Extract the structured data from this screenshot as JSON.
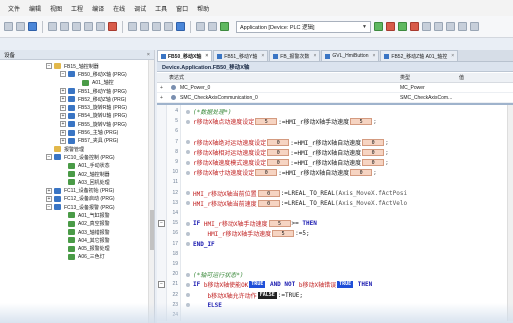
{
  "menu": [
    "文件",
    "编辑",
    "视图",
    "工程",
    "编译",
    "在线",
    "调试",
    "工具",
    "窗口",
    "帮助"
  ],
  "toolbar": {
    "app_select": "Application [Device: PLC 逻辑]"
  },
  "tree_panel": {
    "title": "设备",
    "close": "×",
    "items": [
      {
        "label": "FB15_轴控制器",
        "indent": 46,
        "exp": "−",
        "icon": "fld"
      },
      {
        "label": "FB50_移动X轴 (PRG)",
        "indent": 60,
        "exp": "−",
        "icon": "prg"
      },
      {
        "label": "A01_轴控",
        "indent": 74,
        "exp": "",
        "icon": "act"
      },
      {
        "label": "FB51_移动Y轴 (PRG)",
        "indent": 60,
        "exp": "+",
        "icon": "prg"
      },
      {
        "label": "FB52_移动Z轴 (PRG)",
        "indent": 60,
        "exp": "+",
        "icon": "prg"
      },
      {
        "label": "FB53_旋转R轴 (PRG)",
        "indent": 60,
        "exp": "+",
        "icon": "prg"
      },
      {
        "label": "FB54_旋转U轴 (PRG)",
        "indent": 60,
        "exp": "+",
        "icon": "prg"
      },
      {
        "label": "FB55_旋转V轴 (PRG)",
        "indent": 60,
        "exp": "+",
        "icon": "prg"
      },
      {
        "label": "FB56_主轴 (PRG)",
        "indent": 60,
        "exp": "+",
        "icon": "prg"
      },
      {
        "label": "FB57_夹具 (PRG)",
        "indent": 60,
        "exp": "+",
        "icon": "prg"
      },
      {
        "label": "报警管理",
        "indent": 46,
        "exp": "",
        "icon": "fld"
      },
      {
        "label": "FC10_设备控制 (PRG)",
        "indent": 46,
        "exp": "−",
        "icon": "prg"
      },
      {
        "label": "A01_手动状态",
        "indent": 60,
        "exp": "",
        "icon": "act"
      },
      {
        "label": "A02_轴控制器",
        "indent": 60,
        "exp": "",
        "icon": "act"
      },
      {
        "label": "A03_回机处理",
        "indent": 60,
        "exp": "",
        "icon": "act"
      },
      {
        "label": "FC11_设备初始 (PRG)",
        "indent": 46,
        "exp": "+",
        "icon": "prg"
      },
      {
        "label": "FC12_设备启动 (PRG)",
        "indent": 46,
        "exp": "+",
        "icon": "prg"
      },
      {
        "label": "FC13_设备报警 (PRG)",
        "indent": 46,
        "exp": "−",
        "icon": "prg"
      },
      {
        "label": "A01_气缸报警",
        "indent": 60,
        "exp": "",
        "icon": "act"
      },
      {
        "label": "A02_真空报警",
        "indent": 60,
        "exp": "",
        "icon": "act"
      },
      {
        "label": "A03_轴错报警",
        "indent": 60,
        "exp": "",
        "icon": "act"
      },
      {
        "label": "A04_其它报警",
        "indent": 60,
        "exp": "",
        "icon": "act"
      },
      {
        "label": "A05_报警处理",
        "indent": 60,
        "exp": "",
        "icon": "act"
      },
      {
        "label": "A06_三色灯",
        "indent": 60,
        "exp": "",
        "icon": "act"
      }
    ]
  },
  "tabs": [
    {
      "label": "FB50_移动X轴",
      "active": true
    },
    {
      "label": "FB51_移动Y轴",
      "active": false
    },
    {
      "label": "FB_报警次数",
      "active": false
    },
    {
      "label": "GVL_HmiButton",
      "active": false
    },
    {
      "label": "FB52_移动Z轴 A01_轴控",
      "active": false
    }
  ],
  "editor": {
    "header": "Device.Application.FB50_移动X轴",
    "var_head": {
      "name": "表达式",
      "type": "类型",
      "init": "值"
    },
    "var_rows": [
      {
        "name": "MC_Power_0",
        "type": "MC_Power"
      },
      {
        "name": "SMC_CheckAxisCommunication_0",
        "type": "SMC_CheckAxisCom..."
      }
    ],
    "code": [
      {
        "ln": "4",
        "fold": "",
        "seg": [
          [
            "cmt",
            "(*数据处理*)"
          ]
        ]
      },
      {
        "ln": "5",
        "fold": "",
        "seg": [
          [
            "var",
            "r移动X轴点动速度设定"
          ],
          [
            "ival",
            "5"
          ],
          [
            "op",
            ":=HMI_r移动X轴手动速度"
          ],
          [
            "ival",
            "5"
          ],
          [
            "sym",
            ";"
          ]
        ]
      },
      {
        "ln": "6",
        "fold": "",
        "seg": []
      },
      {
        "ln": "7",
        "fold": "",
        "seg": [
          [
            "var",
            "r移动X轴绝对运动速度设定"
          ],
          [
            "ival",
            "0"
          ],
          [
            "op",
            ":=HMI_r移动X轴自动速度"
          ],
          [
            "ival",
            "0"
          ],
          [
            "sym",
            ";"
          ]
        ]
      },
      {
        "ln": "8",
        "fold": "",
        "seg": [
          [
            "var",
            "r移动X轴相对运动速度设定"
          ],
          [
            "ival",
            "0"
          ],
          [
            "op",
            ":=HMI_r移动X轴自动速度"
          ],
          [
            "ival",
            "0"
          ],
          [
            "sym",
            ";"
          ]
        ]
      },
      {
        "ln": "9",
        "fold": "",
        "seg": [
          [
            "var",
            "r移动X轴速度模式速度设定"
          ],
          [
            "ival",
            "0"
          ],
          [
            "op",
            ":=HMI_r移动X轴自动速度"
          ],
          [
            "ival",
            "0"
          ],
          [
            "sym",
            ";"
          ]
        ]
      },
      {
        "ln": "10",
        "fold": "",
        "seg": [
          [
            "var",
            "r移动X轴寸动速度设定"
          ],
          [
            "ival",
            "0"
          ],
          [
            "op",
            ":=HMI_r移动X轴自动速度"
          ],
          [
            "ival",
            "0"
          ],
          [
            "sym",
            ";"
          ]
        ]
      },
      {
        "ln": "11",
        "fold": "",
        "seg": []
      },
      {
        "ln": "12",
        "fold": "",
        "seg": [
          [
            "var",
            "HMI_r移动X轴当前位置"
          ],
          [
            "ival",
            "0"
          ],
          [
            "op",
            ":=LREAL_TO_REAL"
          ],
          [
            "sym",
            "(Axis_MoveX.fActPosi"
          ]
        ]
      },
      {
        "ln": "13",
        "fold": "",
        "seg": [
          [
            "var",
            "HMI_r移动X轴当前速度"
          ],
          [
            "ival",
            "0"
          ],
          [
            "op",
            ":=LREAL_TO_REAL"
          ],
          [
            "sym",
            "(Axis_MoveX.fActVelo"
          ]
        ]
      },
      {
        "ln": "14",
        "fold": "",
        "seg": []
      },
      {
        "ln": "15",
        "fold": "−",
        "seg": [
          [
            "kw",
            "IF "
          ],
          [
            "var",
            "HMI_r移动X轴手动速度"
          ],
          [
            "ival",
            "5"
          ],
          [
            "op",
            ">= "
          ],
          [
            "kw",
            "THEN"
          ]
        ]
      },
      {
        "ln": "16",
        "fold": "",
        "seg": [
          [
            "op",
            "    "
          ],
          [
            "var",
            "HMI_r移动X轴手动速度"
          ],
          [
            "ival",
            "5"
          ],
          [
            "op",
            ":=5;"
          ]
        ]
      },
      {
        "ln": "17",
        "fold": "",
        "seg": [
          [
            "kw",
            "END_IF"
          ]
        ]
      },
      {
        "ln": "18",
        "fold": "",
        "seg": []
      },
      {
        "ln": "19",
        "fold": "",
        "seg": []
      },
      {
        "ln": "20",
        "fold": "",
        "seg": [
          [
            "cmt",
            "(*轴可运行状态*)"
          ]
        ]
      },
      {
        "ln": "21",
        "fold": "−",
        "seg": [
          [
            "kw",
            "IF "
          ],
          [
            "var",
            "b移动X轴使能OK"
          ],
          [
            "btrue",
            "TRUE"
          ],
          [
            "kw",
            " AND NOT "
          ],
          [
            "var",
            "b移动X轴错误"
          ],
          [
            "btrue",
            "TRUE"
          ],
          [
            "kw",
            " THEN"
          ]
        ]
      },
      {
        "ln": "22",
        "fold": "",
        "seg": [
          [
            "op",
            "    "
          ],
          [
            "var",
            "b移动X轴允许动作"
          ],
          [
            "bfalse",
            "FALSE"
          ],
          [
            "op",
            ":=TRUE;"
          ]
        ]
      },
      {
        "ln": "23",
        "fold": "",
        "seg": [
          [
            "kw",
            "    ELSE"
          ]
        ]
      },
      {
        "ln": "24",
        "fold": "",
        "seg": []
      }
    ]
  }
}
